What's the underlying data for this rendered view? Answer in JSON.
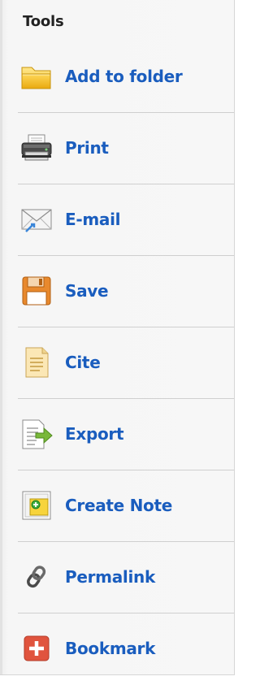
{
  "panel": {
    "title": "Tools",
    "items": [
      {
        "label": "Add to folder",
        "icon": "folder-icon"
      },
      {
        "label": "Print",
        "icon": "printer-icon"
      },
      {
        "label": "E-mail",
        "icon": "email-icon"
      },
      {
        "label": "Save",
        "icon": "save-icon"
      },
      {
        "label": "Cite",
        "icon": "cite-icon"
      },
      {
        "label": "Export",
        "icon": "export-icon"
      },
      {
        "label": "Create Note",
        "icon": "note-icon"
      },
      {
        "label": "Permalink",
        "icon": "link-icon"
      },
      {
        "label": "Bookmark",
        "icon": "bookmark-icon"
      }
    ]
  },
  "colors": {
    "link": "#1a5dbe",
    "title": "#222222",
    "divider": "#cfcfcf",
    "background": "#f7f7f7"
  }
}
